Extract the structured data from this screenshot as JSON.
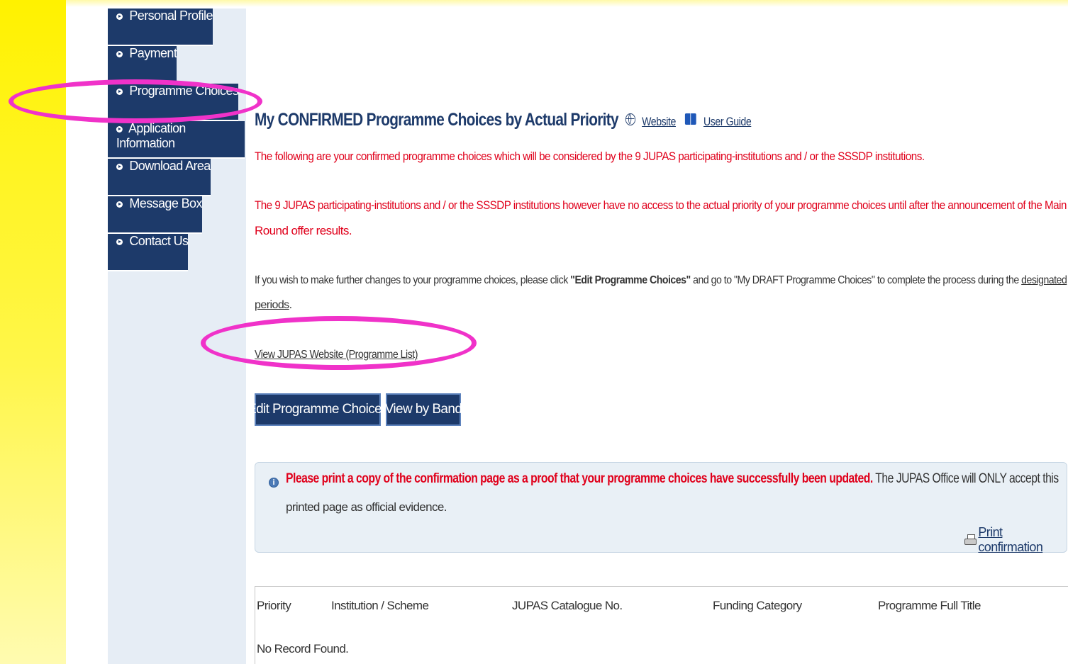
{
  "sidebar": {
    "items": [
      {
        "label": "Personal Profile"
      },
      {
        "label": "Payment"
      },
      {
        "label": "Programme Choices"
      },
      {
        "label": "Application Information"
      },
      {
        "label": "Download Area"
      },
      {
        "label": "Message Box"
      },
      {
        "label": "Contact Us"
      }
    ]
  },
  "main": {
    "title": "My CONFIRMED Programme Choices by Actual Priority",
    "website_link": "Website",
    "user_guide_link": "User Guide",
    "notice_red_1": "The following are your confirmed programme choices which will be considered by the 9 JUPAS participating-institutions and / or the SSSDP institutions.",
    "notice_red_2a": "The 9 JUPAS participating-institutions and / or the SSSDP institutions however have no access to the actual priority of your programme choices until after the announcement of the Main",
    "notice_red_2b": "Round offer results.",
    "instructions_a": "If you wish to make further changes to your programme choices, please click ",
    "instructions_bold": "\"Edit Programme Choices\"",
    "instructions_b": " and go to \"My DRAFT Programme Choices\" to complete the process during the ",
    "instructions_link": "designated",
    "instructions_link2": "periods",
    "instructions_end": ".",
    "view_jupas_link": "View JUPAS Website (Programme List)",
    "edit_button": "Edit Programme Choices",
    "view_band_button": "View by Band",
    "print_notice": {
      "red": "Please print a copy of the confirmation page as a proof that your programme choices have successfully been updated.",
      "gray": " The JUPAS Office will ONLY accept this",
      "line2": "printed page as official evidence.",
      "print_link": "Print confirmation"
    },
    "table": {
      "headers": [
        "Priority",
        "Institution / Scheme",
        "JUPAS Catalogue No.",
        "Funding Category",
        "Programme Full Title"
      ],
      "empty_text": "No Record Found."
    }
  },
  "colors": {
    "nav_bg": "#1d3a6a",
    "sidebar_bg": "#e6edf5",
    "warning_red": "#e0001b",
    "highlight_ellipse": "#f032c9",
    "left_strip_yellow": "#fff200"
  }
}
